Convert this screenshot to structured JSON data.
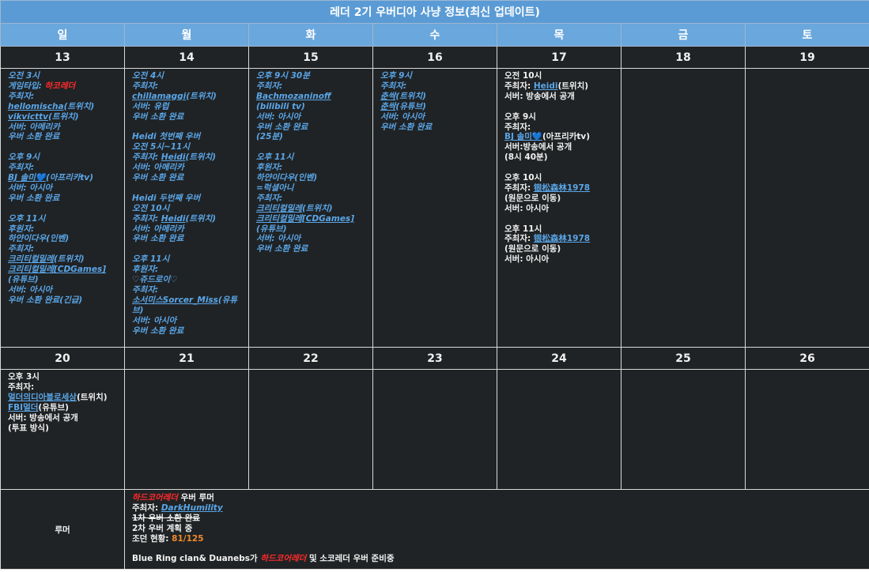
{
  "title": "레더 2기 우버디아 사냥 정보(최신 업데이트)",
  "weekdays": [
    "일",
    "월",
    "화",
    "수",
    "목",
    "금",
    "토"
  ],
  "week1_dates": [
    "13",
    "14",
    "15",
    "16",
    "17",
    "18",
    "19"
  ],
  "week2_dates": [
    "20",
    "21",
    "22",
    "23",
    "24",
    "25",
    "26"
  ],
  "d13": {
    "l1": "오전 3시",
    "l2a": "게임타입: ",
    "l2b": "하코레더",
    "l3": "주최자:",
    "l4a": "hellomischa",
    "l4b": "(트위치)",
    "l5a": "vikvicttv",
    "l5b": "(트위치)",
    "l6": "서버: 아메리카",
    "l7": "우버 소환 완료",
    "l8": "오후 9시",
    "l9": "주최자:",
    "l10a": "BJ 솔미💙",
    "l10b": "(아프리카tv)",
    "l11": "서버: 아시아",
    "l12": "우버 소환 완료",
    "l13": "오후 11시",
    "l14": "후원자:",
    "l15": "하얀이다우(인벤)",
    "l16": "주최자:",
    "l17a": "크리티컬밀레",
    "l17b": "(트위치)",
    "l18a": "크리티컬밀레[CDGames]",
    "l18b": "(유튜브)",
    "l19": "서버: 아시아",
    "l20": "우버 소환 완료(긴급)"
  },
  "d14": {
    "l1": "오전 4시",
    "l2": "주최자:",
    "l3a": "chillamaggi",
    "l3b": "(트위치)",
    "l4": "서버: 유럽",
    "l5": "우버 소환 완료",
    "l6": "Heidi 첫번째 우버",
    "l7": "오전 5시~11시",
    "l8a": "주최자: ",
    "l8b": "Heidi",
    "l8c": "(트위치)",
    "l9": "서버: 아메리카",
    "l10": "우버 소환 완료",
    "l11": "Heidi 두번째 우버",
    "l12": "오전 10시",
    "l13a": "주최자: ",
    "l13b": "Heidi",
    "l13c": "(트위치)",
    "l14": "서버: 아메리카",
    "l15": "우버 소환 완료",
    "l16": "오후 11시",
    "l17": "후원자:",
    "l18": "♡쥬드로이♡",
    "l19": "주최자:",
    "l20a": "소서미스Sorcer_Miss",
    "l20b": "(유튜브)",
    "l21": "서버: 아시아",
    "l22": "우버 소환 완료"
  },
  "d15": {
    "l1": "오후 9시 30분",
    "l2": "주최자:",
    "l3": "Bachmozaninoff",
    "l4": "(bilibili tv)",
    "l5": "서버: 아시아",
    "l6": "우버 소환 완료",
    "l7": "(25분)",
    "l8": "오후 11시",
    "l9": "후원자:",
    "l10": "하얀이다우(인벤)",
    "l11": "=럭셜아니",
    "l12": "주최자:",
    "l13a": "크리티컬밀레",
    "l13b": "(트위치)",
    "l14a": "크리티컬밀레[CDGames]",
    "l14b": "(유튜브)",
    "l15": "서버: 아시아",
    "l16": "우버 소환 완료"
  },
  "d16": {
    "l1": "오후 9시",
    "l2": "주최자:",
    "l3a": "춘싹",
    "l3b": "(트위치)",
    "l4a": "춘싹",
    "l4b": "(유튜브)",
    "l5": "서버: 아시아",
    "l6": "우버 소환 완료"
  },
  "d17": {
    "l1": "오전 10시",
    "l2a": "주최자: ",
    "l2b": "Heidi",
    "l2c": "(트위치)",
    "l3": "서버: 방송에서 공개",
    "l4": "오후 9시",
    "l5": "주최자:",
    "l6a": "BJ 솔미💙",
    "l6b": "(아프리카tv)",
    "l7": "서버:방송에서 공개",
    "l8": "(8시 40분)",
    "l9": "오후 10시",
    "l10a": "주최자: ",
    "l10b": "银松森林1978",
    "l11": "(원문으로 이동)",
    "l12": "서버: 아시아",
    "l13": "오후 11시",
    "l14a": "주최자: ",
    "l14b": "银松森林1978",
    "l15": "(원문으로 이동)",
    "l16": "서버: 아시아"
  },
  "d20": {
    "l1": "오후 3시",
    "l2": "주최자:",
    "l3a": "멀더의디아블로세상",
    "l3b": "(트위치)",
    "l4a": "FBI멀더",
    "l4b": "(유튜브)",
    "l5": "서버: 방송에서 공개",
    "l6": "(투표 방식)"
  },
  "notes": {
    "label": "루머",
    "l1a": "하드코어레더",
    "l1b": " 우버 루머",
    "l2a": "주최자: ",
    "l2b": "DarkHumility",
    "l3": "1차 우버 소환 완료",
    "l4": "2차 우버 계획 중",
    "l5a": "조던 현황: ",
    "l5b": "81/125",
    "l6a": "Blue Ring clan& Duanebs가 ",
    "l6b": "하드코어레더",
    "l6c": " 및 소코레더 우버 준비중"
  }
}
